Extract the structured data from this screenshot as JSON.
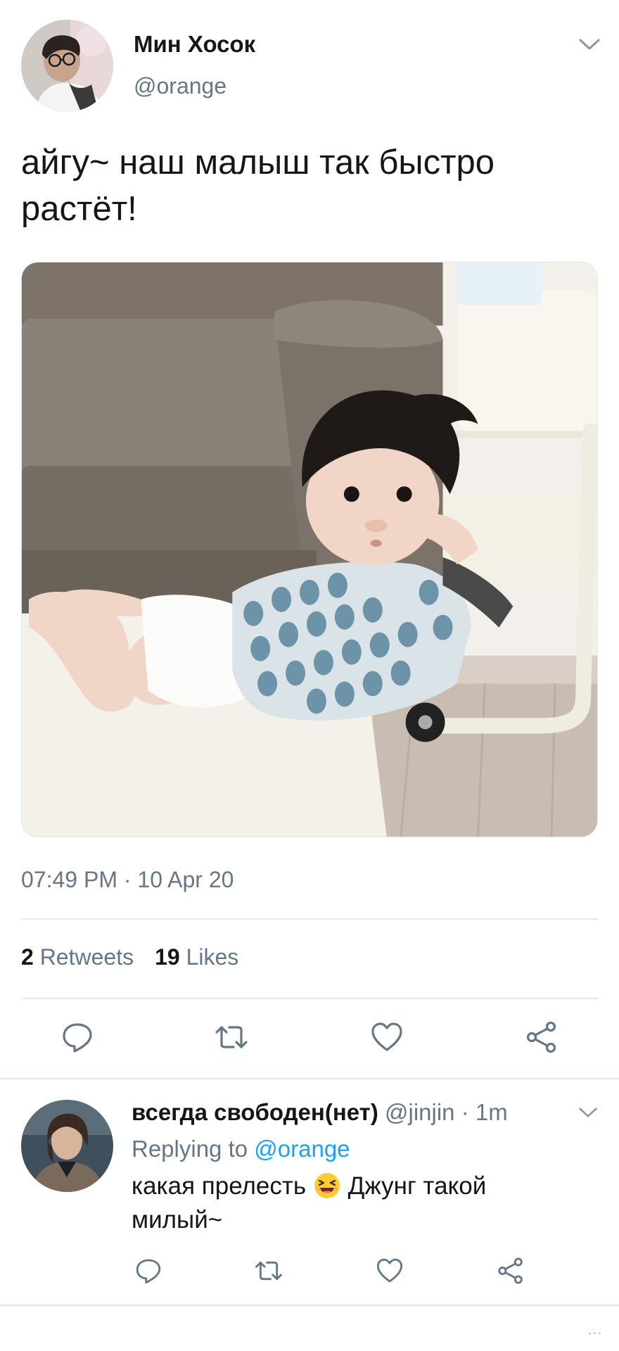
{
  "tweet": {
    "author": {
      "name": "Мин Хосок",
      "handle": "@orange",
      "avatar_icon": "profile-photo-man-glasses"
    },
    "text": "айгу~ наш малыш так быстро растёт!",
    "media_alt": "photo",
    "timestamp": "07:49 PM · 10 Apr 20",
    "stats": {
      "retweets_count": "2",
      "retweets_label": "Retweets",
      "likes_count": "19",
      "likes_label": "Likes"
    },
    "actions": [
      "reply-icon",
      "retweet-icon",
      "like-icon",
      "share-icon"
    ]
  },
  "reply": {
    "author_name": "всегда свободен(нет)",
    "author_handle": "@jinjin",
    "time": "· 1m",
    "replying_prefix": "Replying to",
    "replying_mention": "@orange",
    "text_before_emoji": "какая прелесть",
    "emoji": "grinning-squinting-face",
    "text_after_emoji": "Джунг такой милый~",
    "avatar_icon": "profile-photo-man-long-hair"
  },
  "footer": {
    "more": "..."
  },
  "colors": {
    "text_primary": "#14171a",
    "text_secondary": "#657786",
    "accent": "#1da1f2",
    "divider": "#e1e8ed",
    "icon": "#657786"
  }
}
